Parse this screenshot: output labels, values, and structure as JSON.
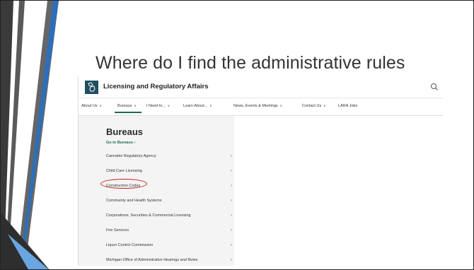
{
  "slide": {
    "title": "Where do I find the administrative rules"
  },
  "site": {
    "agency_name": "Licensing and Regulatory Affairs",
    "logo_icon": "michigan-map-icon",
    "search_icon": "search-icon",
    "accent_color": "#1b6e4a",
    "highlight_color": "#c42020"
  },
  "nav": {
    "items": [
      {
        "label": "About Us"
      },
      {
        "label": "Bureaus"
      },
      {
        "label": "I Need to..."
      },
      {
        "label": "Learn About..."
      },
      {
        "label": "News, Events & Meetings"
      },
      {
        "label": "Contact Us"
      },
      {
        "label": "LARA Jobs"
      }
    ],
    "active": "Bureaus"
  },
  "menu": {
    "heading": "Bureaus",
    "go_link": "Go to Bureaus",
    "items": [
      {
        "label": "Cannabis Regulatory Agency"
      },
      {
        "label": "Child Care Licensing"
      },
      {
        "label": "Construction Codes"
      },
      {
        "label": "Community and Health Systems"
      },
      {
        "label": "Corporations, Securities & Commercial Licensing"
      },
      {
        "label": "Fire Services"
      },
      {
        "label": "Liquor Control Commission"
      },
      {
        "label": "Michigan Office of Administrative Hearings and Rules"
      }
    ],
    "highlighted_item": "Construction Codes"
  }
}
